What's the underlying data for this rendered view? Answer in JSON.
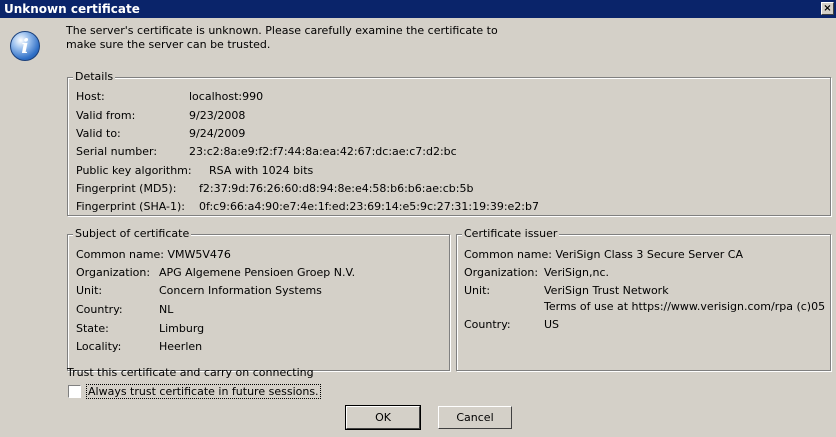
{
  "window": {
    "title": "Unknown certificate",
    "close_glyph": "×",
    "icon": "info-icon"
  },
  "message": {
    "line1": "The server's certificate is unknown. Please carefully examine the certificate to",
    "line2": "make sure the server can be trusted."
  },
  "details": {
    "legend": "Details",
    "rows": [
      {
        "label": "Host:",
        "value": "localhost:990"
      },
      {
        "label": "Valid from:",
        "value": "9/23/2008"
      },
      {
        "label": "Valid to:",
        "value": "9/24/2009"
      },
      {
        "label": "Serial number:",
        "value": "23:c2:8a:e9:f2:f7:44:8a:ea:42:67:dc:ae:c7:d2:bc"
      },
      {
        "label": "Public key algorithm:",
        "value": "RSA with 1024 bits"
      },
      {
        "label": "Fingerprint (MD5):",
        "value": "f2:37:9d:76:26:60:d8:94:8e:e4:58:b6:b6:ae:cb:5b"
      },
      {
        "label": "Fingerprint (SHA-1):",
        "value": "0f:c9:66:a4:90:e7:4e:1f:ed:23:69:14:e5:9c:27:31:19:39:e2:b7"
      }
    ]
  },
  "subject": {
    "legend": "Subject of certificate",
    "common_name": "Common name: VMW5V476",
    "rows": [
      {
        "label": "Organization:",
        "value": "APG Algemene Pensioen Groep N.V."
      },
      {
        "label": "Unit:",
        "value": "Concern Information Systems"
      },
      {
        "label": "Country:",
        "value": "NL"
      },
      {
        "label": "State:",
        "value": "Limburg"
      },
      {
        "label": "Locality:",
        "value": "Heerlen"
      }
    ]
  },
  "issuer": {
    "legend": "Certificate issuer",
    "common_name": "Common name: VeriSign Class 3 Secure Server CA",
    "organization_label": "Organization:",
    "organization_value": "VeriSign,nc.",
    "unit_label": "Unit:",
    "unit_value_line1": "VeriSign Trust Network",
    "unit_value_line2": "Terms of use at https://www.verisign.com/rpa (c)05",
    "country_label": "Country:",
    "country_value": "US"
  },
  "trust": {
    "prompt": "Trust this certificate and carry on connecting",
    "checkbox_label": "Always trust certificate in future sessions.",
    "checked": false
  },
  "buttons": {
    "ok": "OK",
    "cancel": "Cancel"
  }
}
